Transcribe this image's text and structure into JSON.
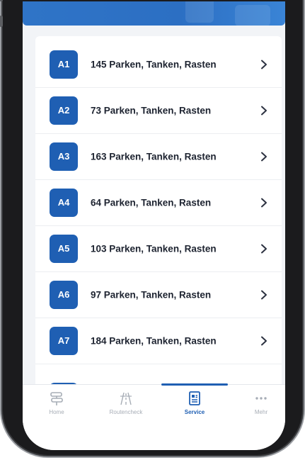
{
  "list": {
    "items": [
      {
        "badge": "A1",
        "label": "145 Parken, Tanken, Rasten"
      },
      {
        "badge": "A2",
        "label": "73 Parken, Tanken, Rasten"
      },
      {
        "badge": "A3",
        "label": "163 Parken, Tanken, Rasten"
      },
      {
        "badge": "A4",
        "label": "64 Parken, Tanken, Rasten"
      },
      {
        "badge": "A5",
        "label": "103 Parken, Tanken, Rasten"
      },
      {
        "badge": "A6",
        "label": "97 Parken, Tanken, Rasten"
      },
      {
        "badge": "A7",
        "label": "184 Parken, Tanken, Rasten"
      },
      {
        "badge": "",
        "label": ""
      }
    ],
    "chevron_icon": "chevron-right-icon"
  },
  "tabbar": {
    "tabs": [
      {
        "label": "Home",
        "icon": "signpost-icon",
        "active": false
      },
      {
        "label": "Routencheck",
        "icon": "road-icon",
        "active": false
      },
      {
        "label": "Service",
        "icon": "document-icon",
        "active": true
      },
      {
        "label": "Mehr",
        "icon": "more-dots-icon",
        "active": false
      }
    ]
  },
  "colors": {
    "accent": "#1f5fb3",
    "header": "#2f74c7",
    "background": "#f2f4f7",
    "text": "#1d2330",
    "tab_inactive": "#a7adb6"
  }
}
